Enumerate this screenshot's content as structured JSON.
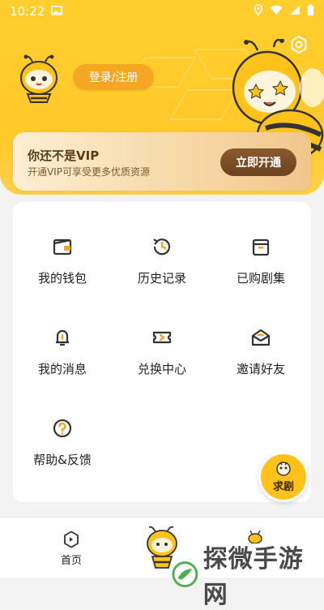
{
  "status_bar": {
    "time": "10:22"
  },
  "header": {
    "login_label": "登录/注册"
  },
  "vip": {
    "title": "你还不是VIP",
    "subtitle": "开通VIP可享受更多优质资源",
    "button_label": "立即开通"
  },
  "menu": {
    "items": [
      {
        "label": "我的钱包",
        "icon": "wallet-icon"
      },
      {
        "label": "历史记录",
        "icon": "history-icon"
      },
      {
        "label": "已购剧集",
        "icon": "purchased-icon"
      },
      {
        "label": "我的消息",
        "icon": "bell-icon"
      },
      {
        "label": "兑换中心",
        "icon": "ticket-icon"
      },
      {
        "label": "邀请好友",
        "icon": "envelope-icon"
      },
      {
        "label": "帮助&反馈",
        "icon": "help-icon"
      }
    ]
  },
  "request": {
    "label": "求剧"
  },
  "bottom_nav": {
    "home_label": "首页"
  },
  "watermark": {
    "text": "探微手游网"
  },
  "colors": {
    "header_yellow": "#ffcf2e",
    "login_orange": "#f5a623",
    "vip_button_brown": "#6b4220",
    "icon_stroke": "#333333",
    "icon_accent": "#f5a623"
  }
}
